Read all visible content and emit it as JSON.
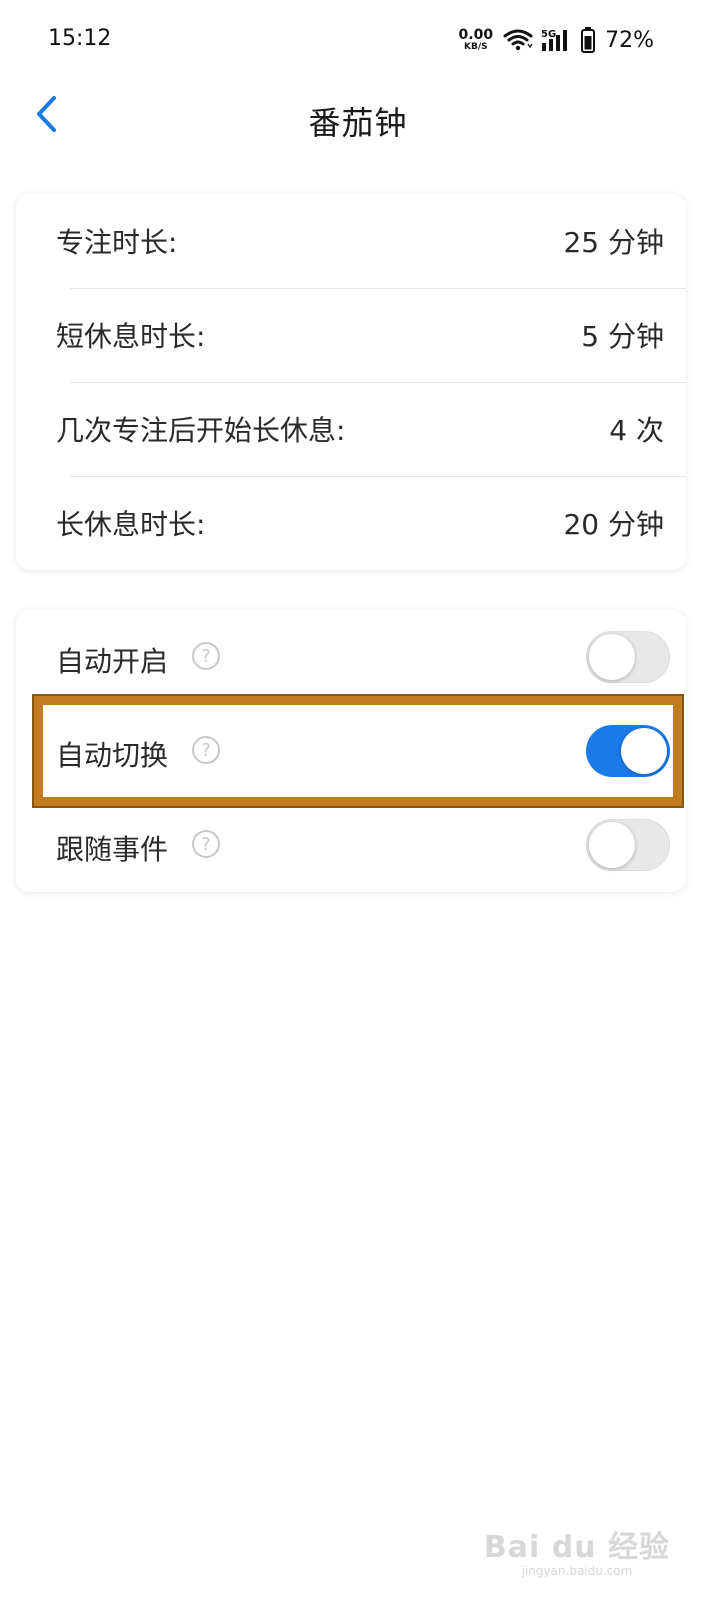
{
  "status_bar": {
    "time": "15:12",
    "net_speed_value": "0.00",
    "net_speed_unit": "KB/S",
    "signal_label": "5G",
    "battery_percent": "72%"
  },
  "header": {
    "title": "番茄钟"
  },
  "durations": [
    {
      "label": "专注时长:",
      "value": "25 分钟"
    },
    {
      "label": "短休息时长:",
      "value": "5 分钟"
    },
    {
      "label": "几次专注后开始长休息:",
      "value": "4 次"
    },
    {
      "label": "长休息时长:",
      "value": "20 分钟"
    }
  ],
  "toggles": [
    {
      "label": "自动开启",
      "help": "?",
      "state": "off"
    },
    {
      "label": "自动切换",
      "help": "?",
      "state": "on"
    },
    {
      "label": "跟随事件",
      "help": "?",
      "state": "off"
    }
  ],
  "watermark": {
    "main": "Bai du 经验",
    "sub": "jingyan.baidu.com"
  },
  "colors": {
    "accent": "#1a7ae8",
    "highlight_box": "#c07c1f"
  }
}
